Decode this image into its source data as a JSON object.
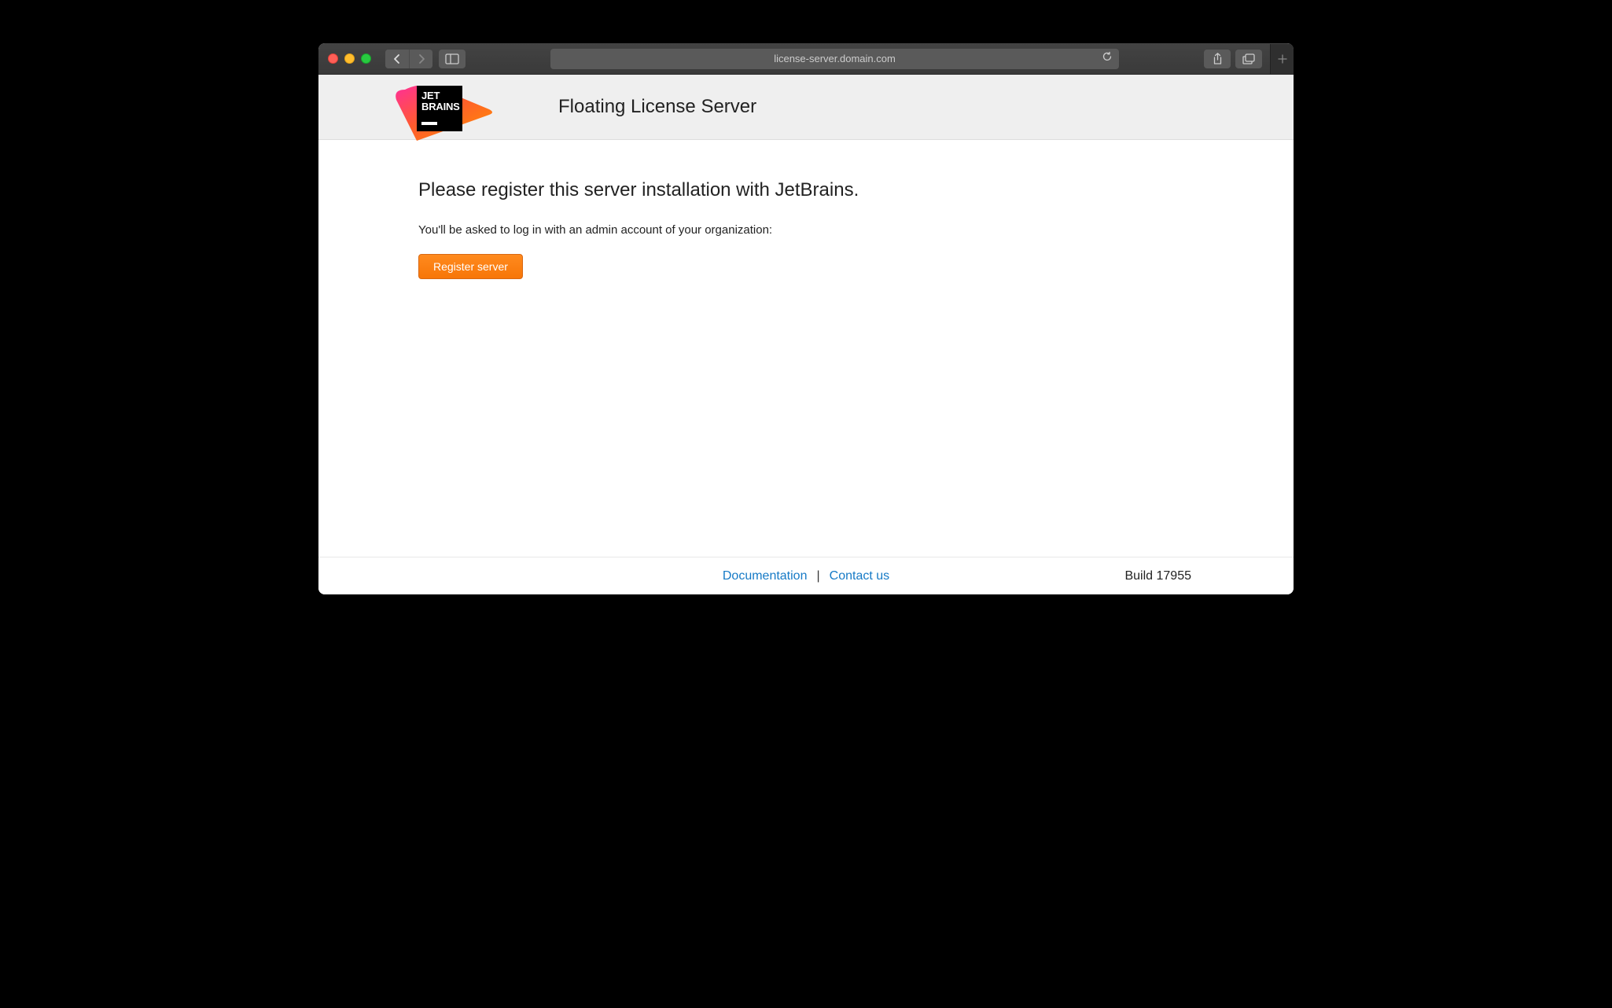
{
  "browser": {
    "address": "license-server.domain.com"
  },
  "header": {
    "logo_text1": "JET",
    "logo_text2": "BRAINS",
    "title": "Floating License Server"
  },
  "content": {
    "heading": "Please register this server installation with JetBrains.",
    "subheading": "You'll be asked to log in with an admin account of your organization:",
    "register_button": "Register server"
  },
  "footer": {
    "documentation": "Documentation",
    "separator": "|",
    "contact": "Contact us",
    "build": "Build 17955"
  }
}
